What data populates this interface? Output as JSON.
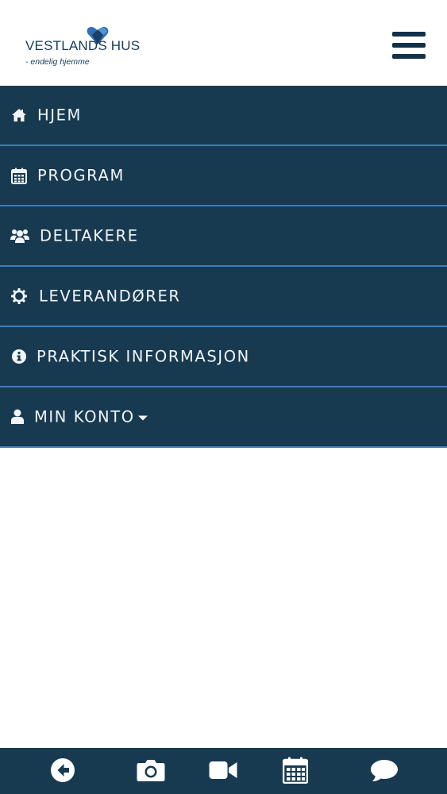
{
  "header": {
    "logo_text": "VESTLANDS HUS",
    "logo_tagline": "- endelig hjemme",
    "menu_button_icon": "hamburger-icon"
  },
  "menu": {
    "items": [
      {
        "label": "HJEM",
        "icon": "home-icon"
      },
      {
        "label": "PROGRAM",
        "icon": "calendar-icon"
      },
      {
        "label": "DELTAKERE",
        "icon": "users-icon"
      },
      {
        "label": "LEVERANDØRER",
        "icon": "gear-icon"
      },
      {
        "label": "PRAKTISK INFORMASJON",
        "icon": "info-icon"
      },
      {
        "label": "MIN KONTO",
        "icon": "user-icon",
        "has_dropdown": true
      }
    ]
  },
  "bottom_bar": {
    "buttons": [
      {
        "icon": "back-arrow-icon"
      },
      {
        "icon": "camera-icon"
      },
      {
        "icon": "video-camera-icon"
      },
      {
        "icon": "calendar-icon"
      },
      {
        "icon": "chat-bubble-icon"
      }
    ]
  },
  "colors": {
    "menu_bg": "#173a51",
    "menu_divider": "#3f7cbf",
    "menu_text": "#f2f5f8",
    "brand_dark": "#163a5c",
    "brand_accent": "#2f6fb3"
  }
}
